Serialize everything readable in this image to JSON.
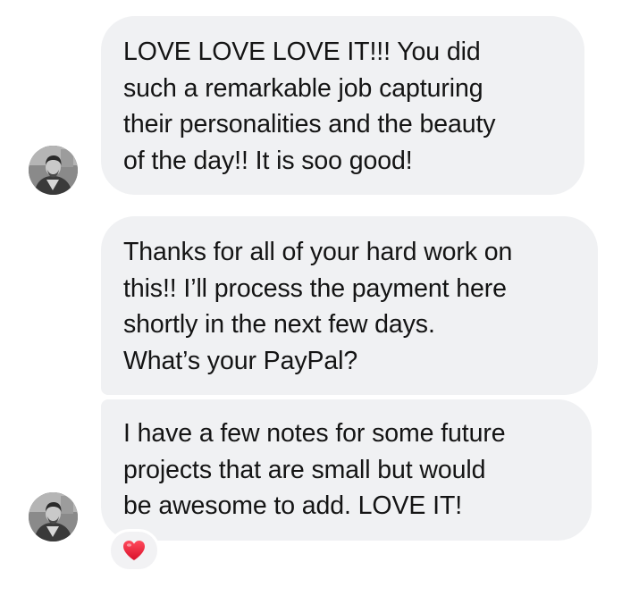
{
  "messages": [
    {
      "lines": [
        "LOVE LOVE LOVE IT!!! You did",
        "such a remarkable job capturing",
        "their personalities and the beauty",
        "of the day!! It is soo good!"
      ]
    },
    {
      "lines": [
        "Thanks for all of your hard work on",
        "this!! I’ll process the payment here",
        "shortly in the next few days.",
        "What’s your PayPal?"
      ]
    },
    {
      "lines": [
        "I have a few notes for some future",
        "projects that are small but would",
        "be awesome to add. LOVE IT!"
      ],
      "reaction": "heart-icon"
    }
  ],
  "colors": {
    "bubble_background": "#f0f1f3",
    "text": "#141414",
    "reaction_heart": "#e8233a"
  }
}
